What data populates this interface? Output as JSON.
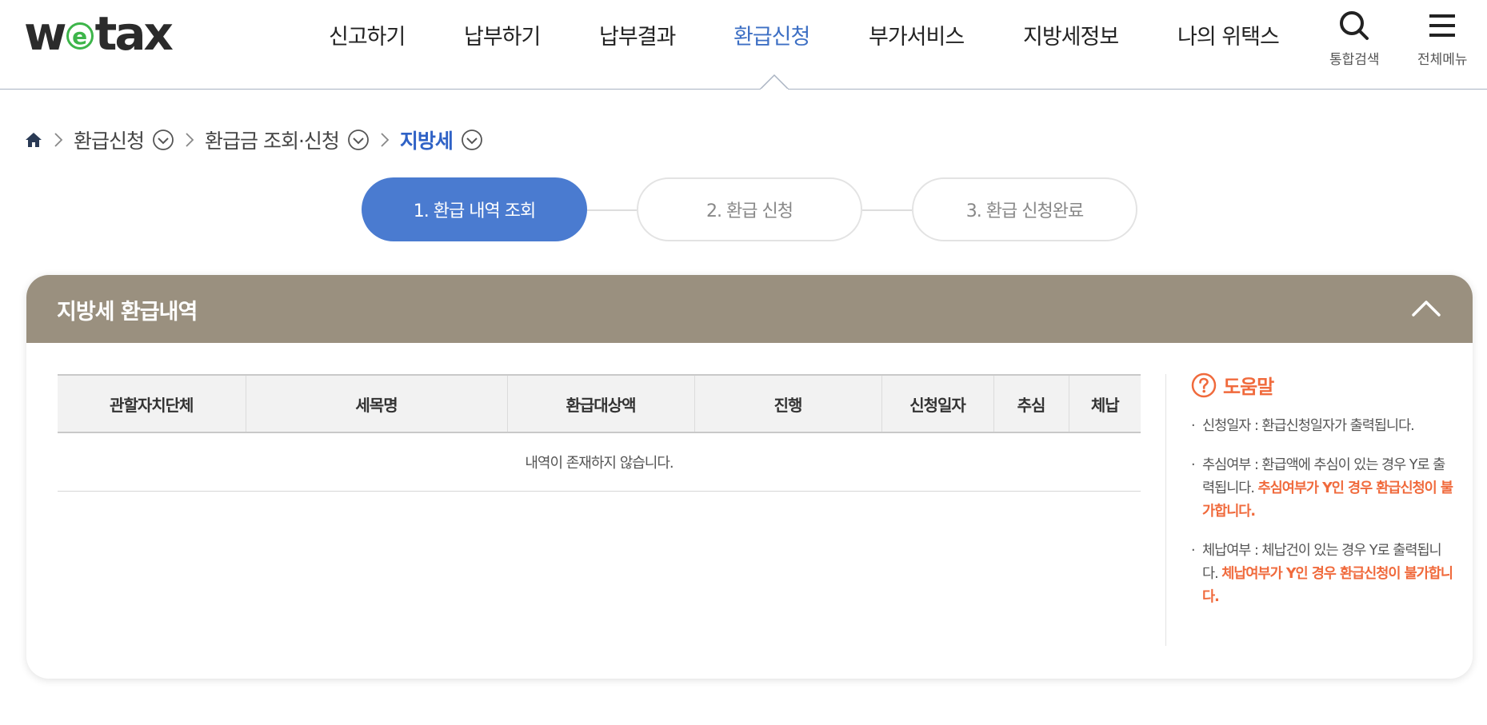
{
  "logo": {
    "pre": "w",
    "circle": "e",
    "post": "tax"
  },
  "nav": {
    "items": [
      {
        "label": "신고하기"
      },
      {
        "label": "납부하기"
      },
      {
        "label": "납부결과"
      },
      {
        "label": "환급신청"
      },
      {
        "label": "부가서비스"
      },
      {
        "label": "지방세정보"
      },
      {
        "label": "나의 위택스"
      }
    ],
    "active_index": 3,
    "search_label": "통합검색",
    "menu_label": "전체메뉴"
  },
  "breadcrumb": {
    "items": [
      "환급신청",
      "환급금 조회·신청",
      "지방세"
    ]
  },
  "steps": [
    {
      "label": "1. 환급 내역 조회",
      "state": "active"
    },
    {
      "label": "2. 환급 신청",
      "state": "inactive"
    },
    {
      "label": "3. 환급 신청완료",
      "state": "inactive"
    }
  ],
  "panel": {
    "title": "지방세 환급내역",
    "table": {
      "headers": [
        "관할자치단체",
        "세목명",
        "환급대상액",
        "진행",
        "신청일자",
        "추심",
        "체납"
      ],
      "empty_message": "내역이 존재하지 않습니다."
    },
    "help": {
      "title": "도움말",
      "items": [
        {
          "text": "신청일자 : 환급신청일자가 출력됩니다.",
          "warn": ""
        },
        {
          "text": "추심여부 : 환급액에 추심이 있는 경우 Y로 출력됩니다. ",
          "warn": "추심여부가 Y인 경우 환급신청이 불가합니다."
        },
        {
          "text": "체납여부 : 체납건이 있는 경우 Y로 출력됩니다. ",
          "warn": "체납여부가 Y인 경우 환급신청이 불가합니다."
        }
      ]
    }
  },
  "colors": {
    "accent": "#3d6fc4",
    "step_active": "#4a7bd0",
    "panel_header": "#9a907f",
    "warning": "#f06a3c",
    "logo_green": "#3db54a"
  }
}
